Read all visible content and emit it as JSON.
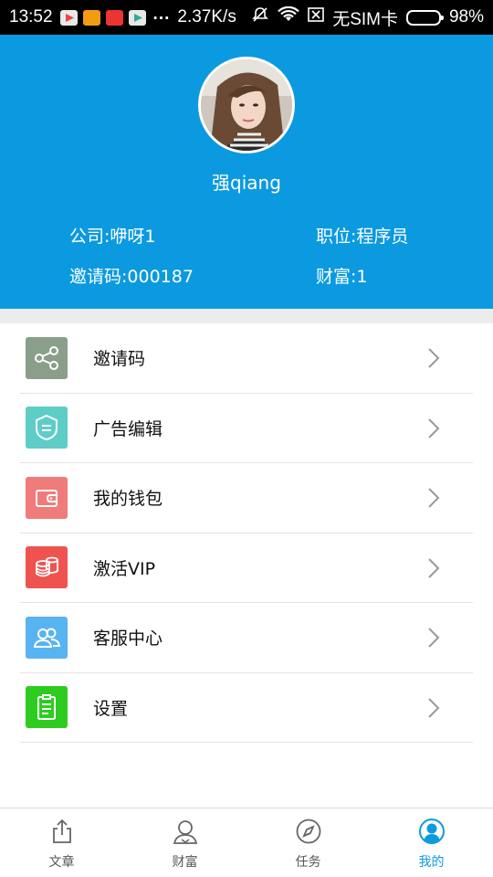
{
  "status_bar": {
    "time": "13:52",
    "dots": "...",
    "speed": "2.37K/s",
    "sim": "无SIM卡",
    "battery": "98%"
  },
  "profile": {
    "username": "强qiang",
    "company": "公司:咿呀1",
    "position": "职位:程序员",
    "invite_code": "邀请码:000187",
    "wealth": "财富:1",
    "colors": {
      "header_bg": "#0b9ae0"
    }
  },
  "menu": {
    "items": [
      {
        "label": "邀请码",
        "icon": "share-icon",
        "color": "#8a9e8a"
      },
      {
        "label": "广告编辑",
        "icon": "badge-icon",
        "color": "#5ecdc8"
      },
      {
        "label": "我的钱包",
        "icon": "wallet-icon",
        "color": "#f07b7b"
      },
      {
        "label": "激活VIP",
        "icon": "coins-icon",
        "color": "#ef5350"
      },
      {
        "label": "客服中心",
        "icon": "people-icon",
        "color": "#58b4f0"
      },
      {
        "label": "设置",
        "icon": "clipboard-icon",
        "color": "#2ecc20"
      }
    ]
  },
  "tabs": [
    {
      "label": "文章",
      "icon": "share-up-icon",
      "active": false
    },
    {
      "label": "财富",
      "icon": "user-outline-icon",
      "active": false
    },
    {
      "label": "任务",
      "icon": "compass-icon",
      "active": false
    },
    {
      "label": "我的",
      "icon": "profile-icon",
      "active": true
    }
  ]
}
